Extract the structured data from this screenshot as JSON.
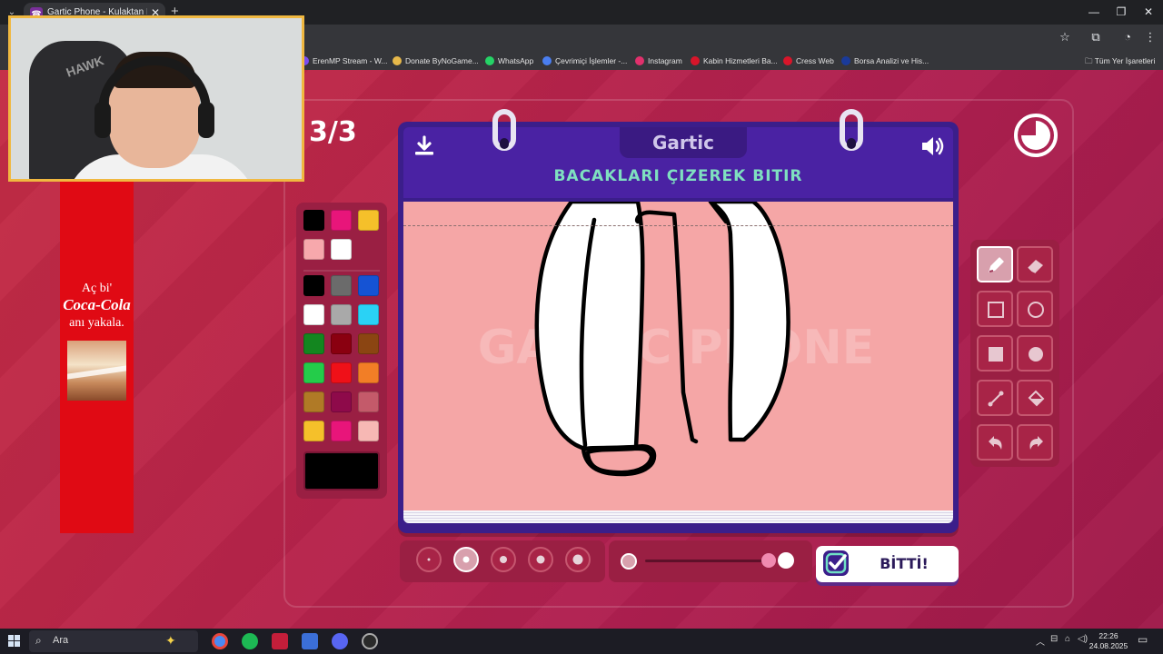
{
  "browser": {
    "tab_title": "Gartic Phone - Kulaktan Kulağa",
    "tab_favicon": "☎",
    "bookmarks": [
      {
        "label": "ErenMP Stream - W...",
        "color": "#7a4df0"
      },
      {
        "label": "Donate ByNoGame...",
        "color": "#e6b84a"
      },
      {
        "label": "WhatsApp",
        "color": "#25d366"
      },
      {
        "label": "Çevrimiçi İşlemler -...",
        "color": "#4a7ef0"
      },
      {
        "label": "Instagram",
        "color": "#e1306c"
      },
      {
        "label": "Kabin Hizmetleri Ba...",
        "color": "#d8152a"
      },
      {
        "label": "Cress Web",
        "color": "#d8152a"
      },
      {
        "label": "Borsa Analizi ve His...",
        "color": "#1a3a9a"
      }
    ],
    "all_bookmarks": "Tüm Yer İşaretleri"
  },
  "ad": {
    "line1": "Aç bi'",
    "brand": "Coca-Cola",
    "line3": "anı yakala."
  },
  "game": {
    "round": "3/3",
    "logo": "Gartic",
    "instruction": "BACAKLARI ÇIZEREK BITIR",
    "done_label": "BİTTİ!",
    "watermark": "GARTIC PHONE",
    "timer_fraction": 0.75
  },
  "palette": {
    "top": [
      "#000000",
      "#e8157a",
      "#f5c02a",
      "#f7a8ac",
      "#ffffff"
    ],
    "grid": [
      "#000000",
      "#6b6b6b",
      "#1553d4",
      "#ffffff",
      "#a9a9a9",
      "#2ad2f5",
      "#13861f",
      "#8a0010",
      "#8b4512",
      "#24cc4a",
      "#ef1018",
      "#f27e26",
      "#b07a26",
      "#8e0a4a",
      "#c45a6a",
      "#f5c02a",
      "#e8157a",
      "#f7b8b4"
    ],
    "current": "#000000"
  },
  "tools": [
    "pen-icon",
    "eraser-icon",
    "rectangle-outline-icon",
    "circle-outline-icon",
    "rectangle-filled-icon",
    "circle-filled-icon",
    "line-icon",
    "fill-bucket-icon",
    "undo-icon",
    "redo-icon"
  ],
  "brush_sizes": {
    "count": 5,
    "selected_index": 1
  },
  "opacity": {
    "value": 1.0
  },
  "taskbar": {
    "search_placeholder": "Ara",
    "time": "22:26",
    "date": "24.08.2025"
  }
}
